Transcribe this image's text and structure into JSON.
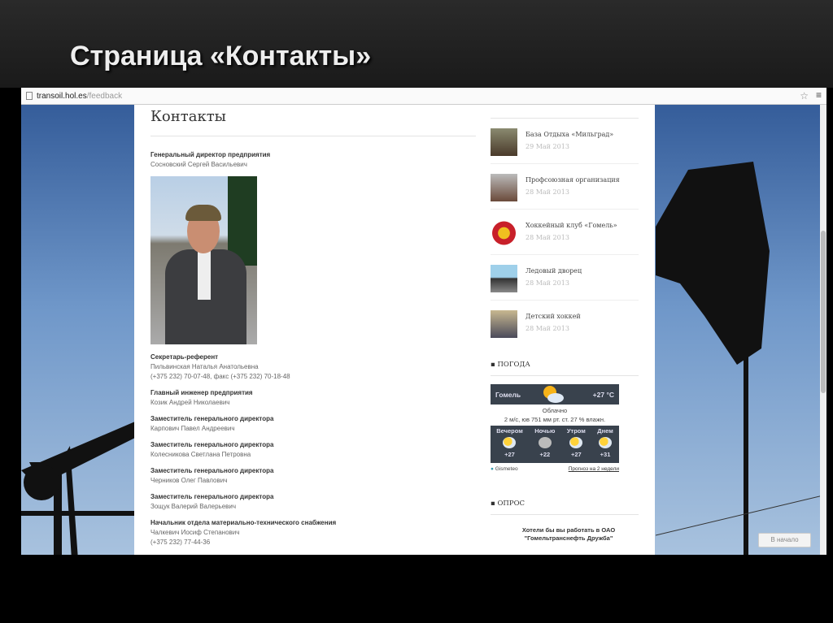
{
  "slide": {
    "title": "Страница «Контакты»"
  },
  "browser": {
    "url_domain": "transoil.hol.es",
    "url_path": "/feedback"
  },
  "page": {
    "heading": "Контакты",
    "contacts": [
      {
        "role": "Генеральный директор предприятия",
        "name": "Сосновский Сергей Васильевич"
      },
      {
        "role": "Секретарь-референт",
        "name": "Пильвинская Наталья Анатольевна",
        "phone": "(+375 232) 70-07-48,  факс (+375 232) 70-18-48"
      },
      {
        "role": "Главный инженер предприятия",
        "name": "Козик Андрей Николаевич"
      },
      {
        "role": "Заместитель генерального директора",
        "name": "Карпович Павел Андреевич"
      },
      {
        "role": "Заместитель генерального директора",
        "name": "Колесникова Светлана Петровна"
      },
      {
        "role": "Заместитель генерального директора",
        "name": "Черников Олег Павлович"
      },
      {
        "role": "Заместитель генерального директора",
        "name": "Зощук Валерий Валерьевич"
      },
      {
        "role": "Начальник отдела материально-технического снабжения",
        "name": "Чалкевич Иосиф Степанович",
        "phone": "(+375 232) 77-44-36"
      }
    ]
  },
  "news": [
    {
      "title": "База Отдыха «Мильград»",
      "date": "29 Май 2013"
    },
    {
      "title": "Профсоюзная организация",
      "date": "28 Май 2013"
    },
    {
      "title": "Хоккейный клуб «Гомель»",
      "date": "28 Май 2013"
    },
    {
      "title": "Ледовый дворец",
      "date": "28 Май 2013"
    },
    {
      "title": "Детский хоккей",
      "date": "28 Май 2013"
    }
  ],
  "weather": {
    "section": "ПОГОДА",
    "city": "Гомель",
    "temp": "+27 °C",
    "condition": "Облачно",
    "details": "2 м/с, юв  751 мм рт. ст.  27 % влажн.",
    "forecast": [
      {
        "label": "Вечером",
        "temp": "+27"
      },
      {
        "label": "Ночью",
        "temp": "+22"
      },
      {
        "label": "Утром",
        "temp": "+27"
      },
      {
        "label": "Днем",
        "temp": "+31"
      }
    ],
    "provider": "Gismeteo",
    "link": "Прогноз на 2 недели"
  },
  "poll": {
    "section": "ОПРОС",
    "question_line1": "Хотели бы вы работать в ОАО",
    "question_line2": "\"Гомельтранснефть Дружба\""
  },
  "to_top": "В начало"
}
